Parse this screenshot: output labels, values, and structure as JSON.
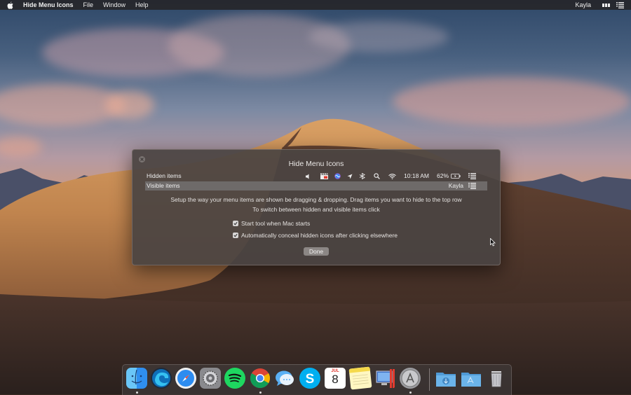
{
  "menubar": {
    "app_name": "Hide Menu Icons",
    "menus": [
      "File",
      "Window",
      "Help"
    ],
    "user": "Kayla",
    "icons": [
      "apple-icon",
      "battery-bars-icon",
      "list-menu-icon"
    ]
  },
  "dialog": {
    "title": "Hide Menu Icons",
    "hidden_row": {
      "label": "Hidden items",
      "icons": [
        "volume-icon",
        "clapperboard-icon",
        "siri-icon",
        "location-arrow-icon",
        "bluetooth-icon",
        "search-icon",
        "wifi-icon"
      ],
      "time": "10:18 AM",
      "battery": "62%"
    },
    "visible_row": {
      "label": "Visible items",
      "user": "Kayla"
    },
    "instruction_line1": "Setup the way your menu items are shown be dragging & dropping. Drag items you want to hide to the top row",
    "instruction_line2": "To switch between hidden and visible items click",
    "checkboxes": [
      {
        "label": "Start tool when Mac starts",
        "checked": true
      },
      {
        "label": "Automatically conceal hidden icons after clicking elsewhere",
        "checked": true
      }
    ],
    "done_label": "Done"
  },
  "dock": {
    "apps": [
      "finder-icon",
      "edge-icon",
      "safari-icon",
      "system-preferences-icon",
      "spotify-icon",
      "chrome-icon",
      "messages-icon",
      "skype-icon",
      "calendar-icon",
      "notes-icon",
      "remote-desktop-icon",
      "app-store-icon",
      "downloads-folder-icon",
      "applications-folder-icon",
      "trash-icon"
    ],
    "calendar": {
      "month": "JUL",
      "day": "8"
    }
  }
}
